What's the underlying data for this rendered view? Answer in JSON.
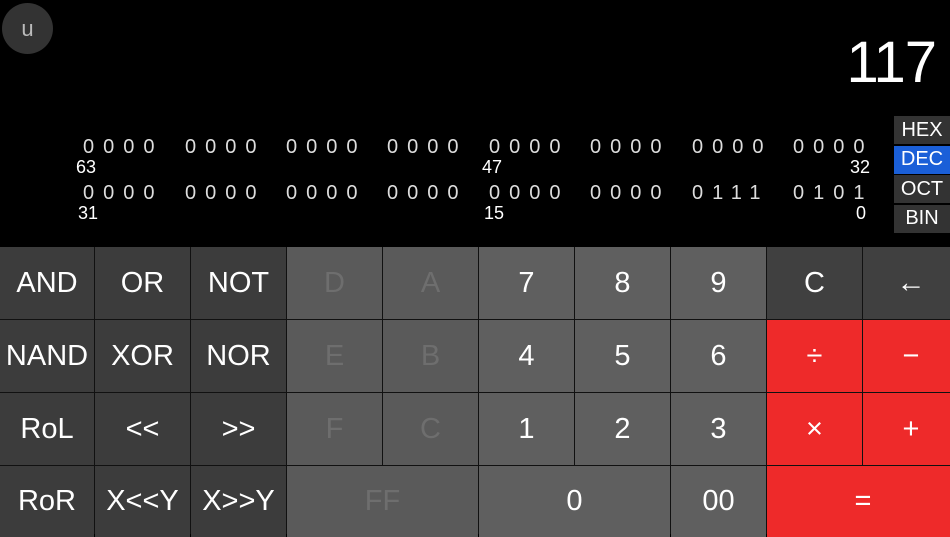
{
  "profile": {
    "initial": "u"
  },
  "display": {
    "value": "117"
  },
  "bits": {
    "row1": [
      "0000",
      "0000",
      "0000",
      "0000",
      "0000",
      "0000",
      "0000",
      "0000"
    ],
    "row2": [
      "0000",
      "0000",
      "0000",
      "0000",
      "0000",
      "0000",
      "0111",
      "0101"
    ],
    "labels_row1": {
      "left": "63",
      "mid": "47",
      "right": "32"
    },
    "labels_row2": {
      "left": "31",
      "mid": "15",
      "right": "0"
    }
  },
  "base": {
    "options": [
      "HEX",
      "DEC",
      "OCT",
      "BIN"
    ],
    "selected": "DEC"
  },
  "keys": {
    "and": "AND",
    "or": "OR",
    "not": "NOT",
    "d": "D",
    "a": "A",
    "seven": "7",
    "eight": "8",
    "nine": "9",
    "clear": "C",
    "backspace": "←",
    "nand": "NAND",
    "xor": "XOR",
    "nor": "NOR",
    "e": "E",
    "b": "B",
    "four": "4",
    "five": "5",
    "six": "6",
    "divide": "÷",
    "minus": "−",
    "rol": "RoL",
    "shl": "<<",
    "shr": ">>",
    "f": "F",
    "c": "C",
    "one": "1",
    "two": "2",
    "three": "3",
    "multiply": "×",
    "plus": "+",
    "ror": "RoR",
    "xshly": "X<<Y",
    "xshry": "X>>Y",
    "ff": "FF",
    "zero": "0",
    "double_zero": "00",
    "equals": "="
  },
  "colors": {
    "accent": "#1a5fd8",
    "operator": "#ee2a2a"
  }
}
